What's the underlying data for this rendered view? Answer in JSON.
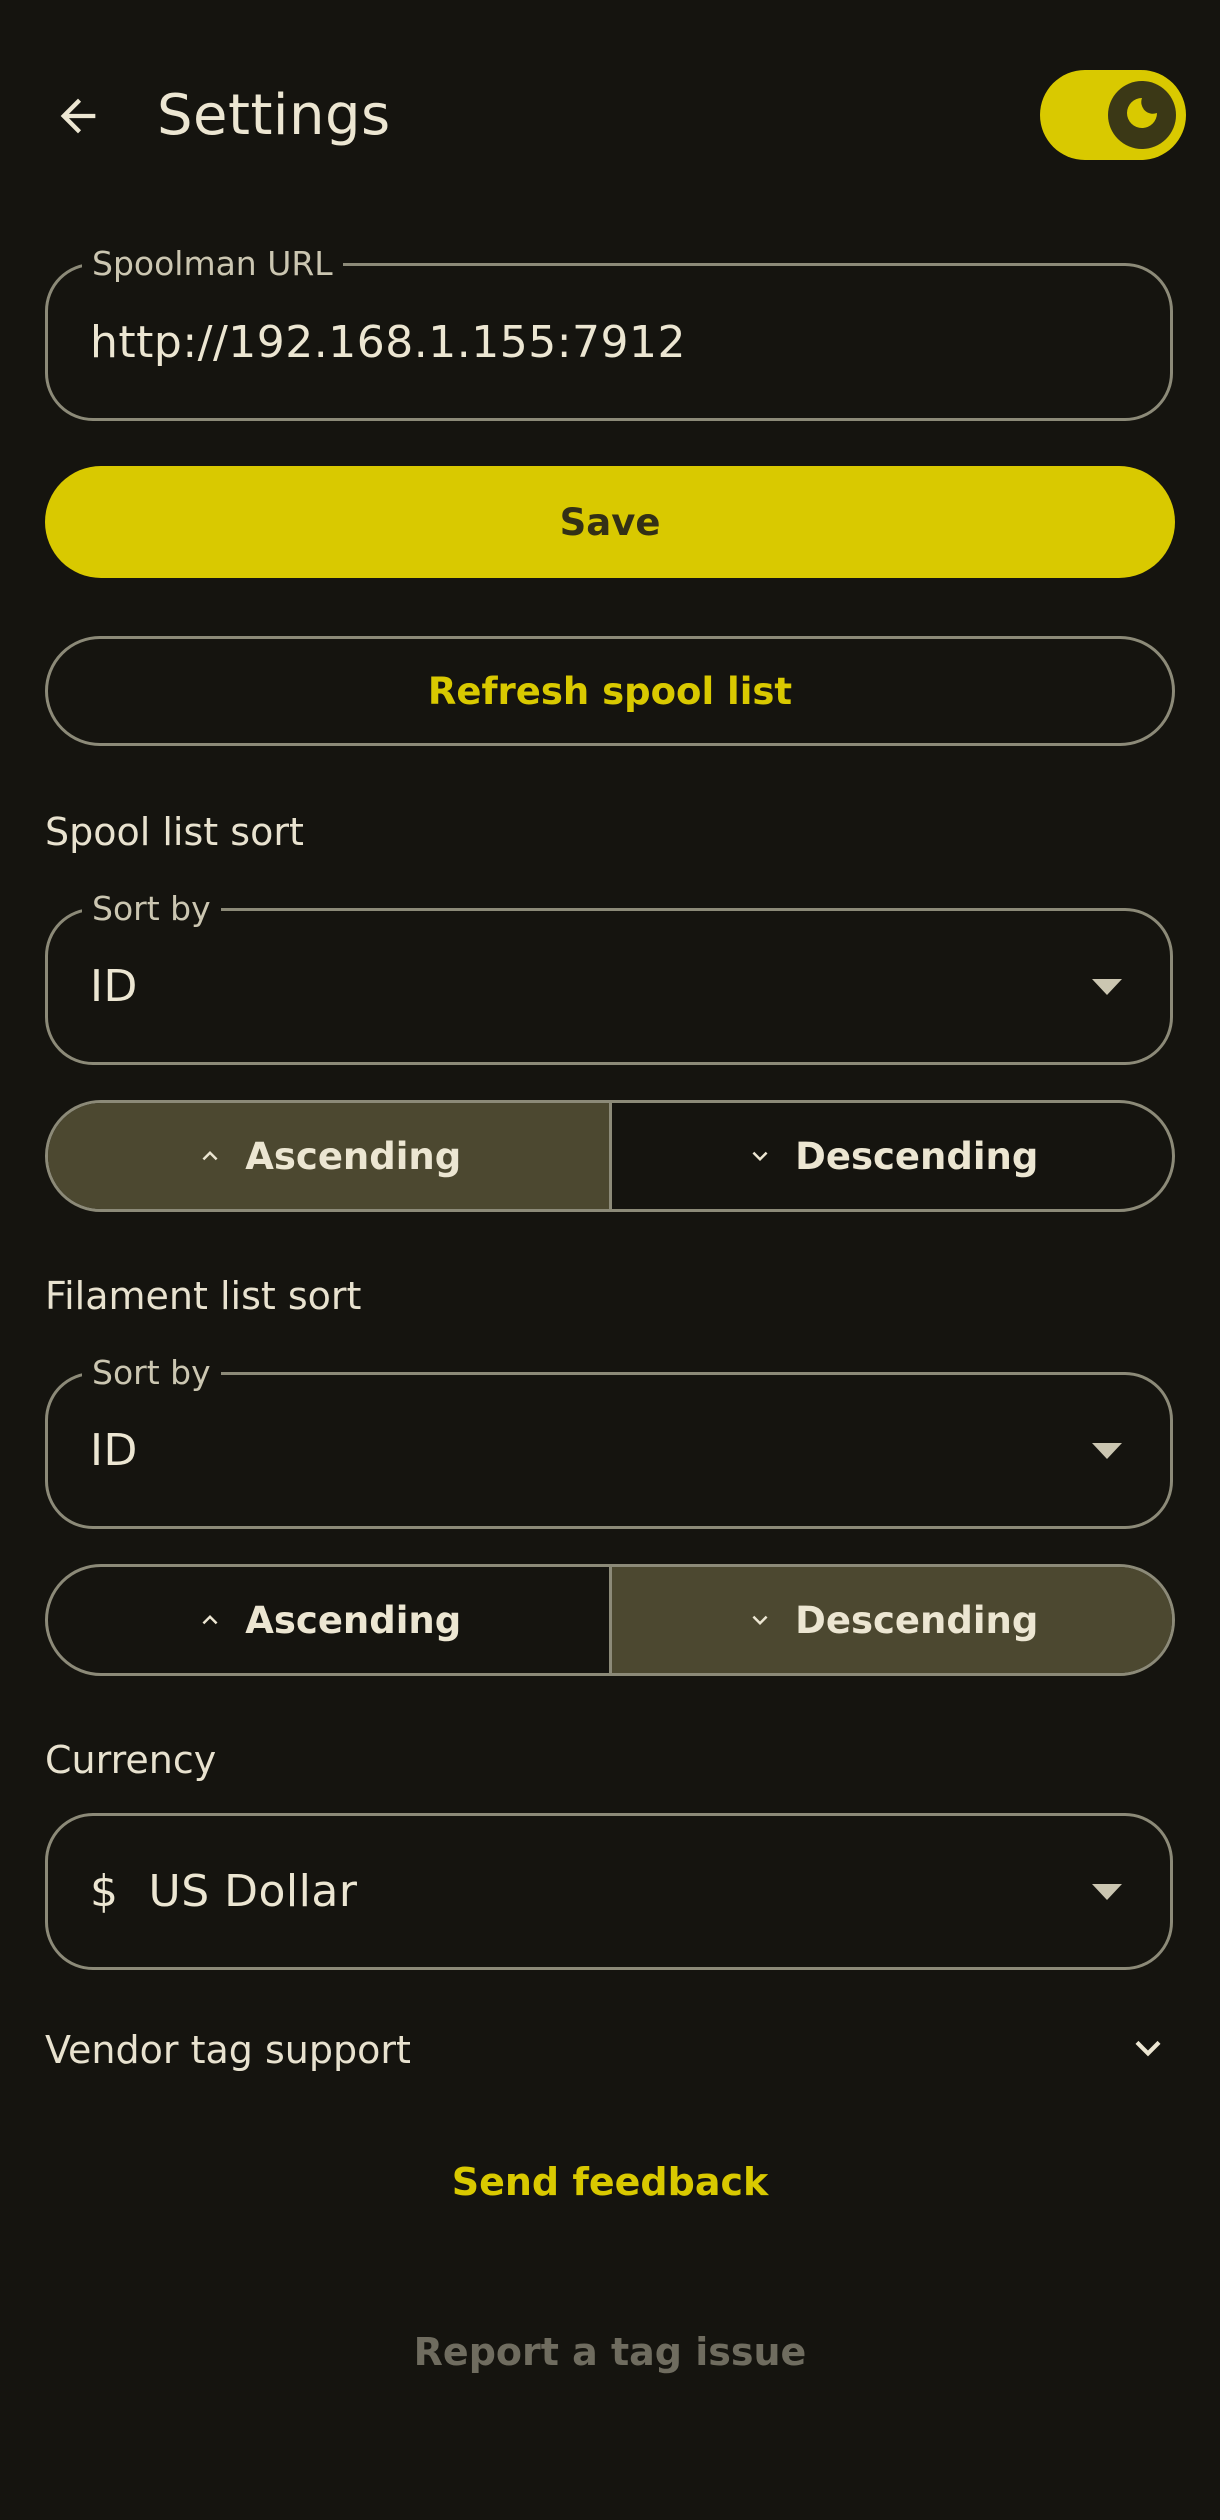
{
  "header": {
    "title": "Settings",
    "back_icon": "arrow-left-icon",
    "theme_toggle": {
      "state": "dark",
      "icon": "moon-icon",
      "on": true
    }
  },
  "spoolman": {
    "label": "Spoolman URL",
    "value": "http://192.168.1.155:7912",
    "save_label": "Save",
    "refresh_label": "Refresh spool list"
  },
  "spool_sort": {
    "section_label": "Spool list sort",
    "field_label": "Sort by",
    "value": "ID",
    "ascending_label": "Ascending",
    "descending_label": "Descending",
    "selected": "ascending"
  },
  "filament_sort": {
    "section_label": "Filament list sort",
    "field_label": "Sort by",
    "value": "ID",
    "ascending_label": "Ascending",
    "descending_label": "Descending",
    "selected": "descending"
  },
  "currency": {
    "section_label": "Currency",
    "symbol": "$",
    "value": "US Dollar"
  },
  "vendor": {
    "label": "Vendor tag support",
    "expanded": false
  },
  "links": {
    "feedback": "Send feedback",
    "report": "Report a tag issue"
  },
  "colors": {
    "background": "#15140f",
    "accent": "#d9c900",
    "selected_segment": "#4c4830",
    "outline": "#8c8a78",
    "muted": "#6f6c5f"
  }
}
